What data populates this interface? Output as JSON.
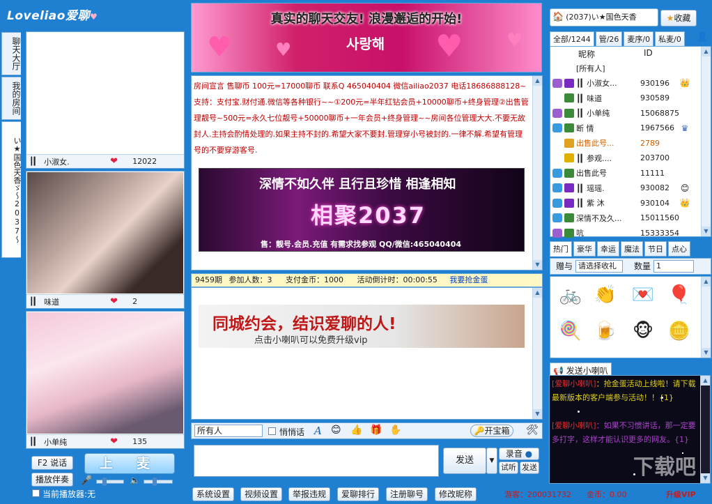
{
  "app": {
    "logo": "Loveliao爱聊"
  },
  "left_tabs": [
    "聊天大厅",
    "我的房间",
    "い★国色天香ゞ～2037～"
  ],
  "videos": [
    {
      "marker": "┃▎",
      "name": "小淑女.",
      "count": "12022"
    },
    {
      "marker": "┃▎",
      "name": "味道",
      "count": "2"
    },
    {
      "marker": "┃▎",
      "name": "小单纯",
      "count": "135"
    }
  ],
  "left_controls": {
    "speak_button": "F2  说话",
    "mic_button": "上 麦",
    "accompany_button": "播放伴奏",
    "player_label": "当前播放器:无"
  },
  "banner": {
    "text": "真实的聊天交友! 浪漫邂逅的开始!",
    "korean": "사랑해"
  },
  "notice": "房间宣言  售聊币  100元=17000聊币  联系Q  465040404  微信ailiao2037  电话18686888128~支持：支付宝.财付通.微信等各种银行~~①200元=半年红钻会员+10000聊币+终身管理②出售管理靓号~500元=永久七位靓号+50000聊币+一年会员+终身管理~~房间各位管理大大.不要无故封人.主持会酌情处理的.如果主持不封的.希望大家不要封.管理穿小号被封的.一律不解.希望有管理号的不要穿游客号.",
  "ad1": {
    "line1": "深情不如久伴  且行且珍惜  相逢相知",
    "line2": "相聚2037",
    "line3": "售：靓号.会员.充值  有需求找参观    QQ/微信:465040404"
  },
  "lottery": {
    "period": "9459期",
    "participants_label": "参加人数：3",
    "gold_label": "支付金币：1000",
    "countdown_label": "活动倒计时：00:00:55",
    "grab_link": "我要抢金蛋"
  },
  "ad2": {
    "line1": "同城约会，结识爱聊的人!",
    "line2": "点击小喇叭可以免费升级vip"
  },
  "input_bar": {
    "target": "所有人",
    "whisper": "悄悄话",
    "treasure_button": "开宝箱"
  },
  "send": {
    "send_button": "发送",
    "record_button": "录音",
    "audition_button": "试听",
    "send_small": "发送"
  },
  "bottom_buttons": [
    "系统设置",
    "视频设置",
    "举报违规",
    "爱聊排行",
    "注册聊号",
    "修改昵称"
  ],
  "status": {
    "guest_label": "游客：",
    "guest_id": "200031732",
    "gold_label": "金币：",
    "gold_value": "0.00",
    "upgrade": "升级VIP"
  },
  "room": {
    "title": "(2037)い★国色天香",
    "favorite_button": "收藏"
  },
  "user_tabs": [
    "全部/1244",
    "管/26",
    "麦序/0",
    "私麦/0"
  ],
  "user_columns": {
    "nick": "昵称",
    "id": "ID"
  },
  "users": [
    {
      "name": "[所有人]",
      "id": "",
      "icon": "",
      "b1": "",
      "b2": ""
    },
    {
      "name": "┃▎小淑女...",
      "id": "930196",
      "icon": "crown",
      "b1": "#9b5fd0",
      "b2": "#7a2ac0"
    },
    {
      "name": "┃▎味道",
      "id": "930589",
      "icon": "",
      "b1": "",
      "b2": "#3a8a3a"
    },
    {
      "name": "┃▎小单纯",
      "id": "15068875",
      "icon": "",
      "b1": "#9b5fd0",
      "b2": "#3a8a3a"
    },
    {
      "name": "  断  情",
      "id": "1967566",
      "icon": "crown-blue",
      "b1": "#3a9ae0",
      "b2": "#3a8a3a"
    },
    {
      "name": "出售此号...",
      "id": "2789",
      "icon": "",
      "b1": "",
      "b2": "#e0a020",
      "orange": true
    },
    {
      "name": "┃▎参观....",
      "id": "203700",
      "icon": "",
      "b1": "",
      "b2": "#e0b000"
    },
    {
      "name": "出售此号",
      "id": "11111",
      "icon": "",
      "b1": "#3a9ae0",
      "b2": "#3a8a3a"
    },
    {
      "name": "┃▎瑶瑶.",
      "id": "930082",
      "icon": "smile",
      "b1": "#3a9ae0",
      "b2": "#7a2ac0"
    },
    {
      "name": "┃▎紫  沐",
      "id": "930104",
      "icon": "crown",
      "b1": "#3a9ae0",
      "b2": "#7a2ac0"
    },
    {
      "name": "深情不及久...",
      "id": "15011560",
      "icon": "",
      "b1": "#3a9ae0",
      "b2": "#3a8a3a"
    },
    {
      "name": "吭",
      "id": "15333354",
      "icon": "",
      "b1": "#9b5fd0",
      "b2": "#3a8a3a"
    }
  ],
  "gift_tabs": [
    "热门",
    "豪华",
    "幸运",
    "魔法",
    "节日",
    "点心"
  ],
  "gift_row": {
    "give_label": "赠与",
    "recipient": "请选择收礼",
    "qty_label": "数量",
    "qty": "1"
  },
  "gifts": [
    "🚲",
    "👏",
    "💌",
    "🎈",
    "🍭",
    "🍺",
    "🐵",
    "🪙"
  ],
  "horn": {
    "tab": "发送小喇叭"
  },
  "horn_messages": [
    {
      "sender": "[爱聊小喇叭]",
      "text": "：抢金蛋活动上线啦！请下载最新版本的客户端参与活动！！{1}"
    },
    {
      "sender": "[爱聊小喇叭]",
      "text": "：如果不习惯讲话，那一定要多打字，这样才能认识更多的网友。{1}"
    }
  ],
  "watermark": "下载吧"
}
